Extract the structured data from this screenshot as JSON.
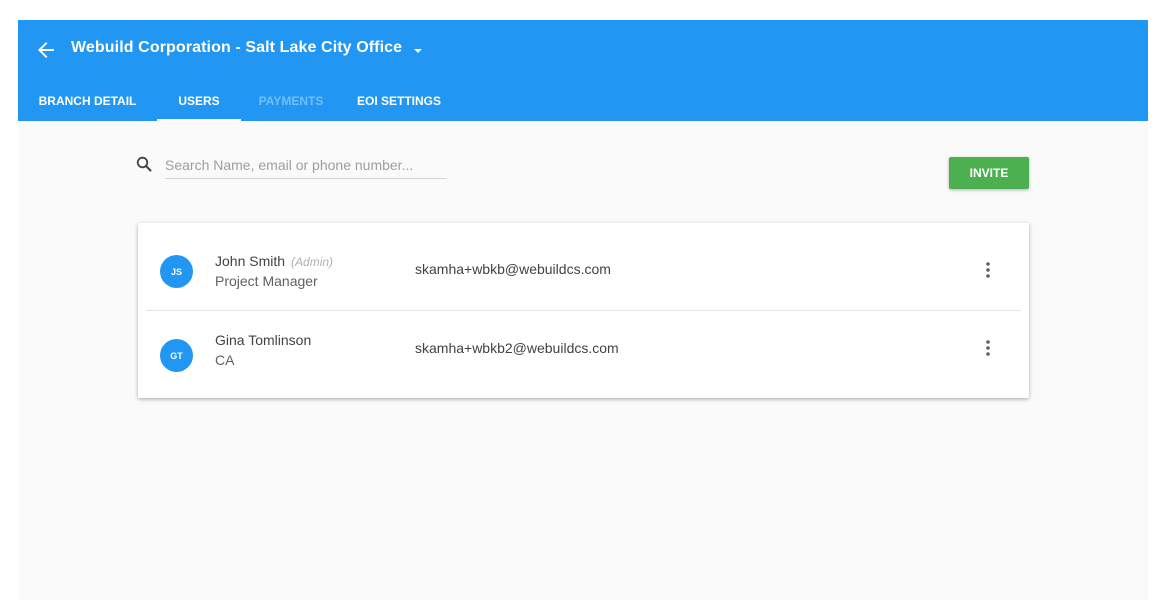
{
  "appbar": {
    "title": "Webuild Corporation - Salt Lake City Office",
    "back_icon": "arrow-left-icon",
    "caret_icon": "caret-down-icon",
    "color": "#2196f3"
  },
  "tabs": [
    {
      "label": "BRANCH DETAIL",
      "state": "normal"
    },
    {
      "label": "USERS",
      "state": "active"
    },
    {
      "label": "PAYMENTS",
      "state": "disabled"
    },
    {
      "label": "EOI SETTINGS",
      "state": "normal"
    }
  ],
  "search": {
    "placeholder": "Search Name, email or phone number...",
    "value": "",
    "icon": "search-icon"
  },
  "invite": {
    "label": "INVITE",
    "color": "#4caf50"
  },
  "users": [
    {
      "initials": "JS",
      "name": "John Smith",
      "tag": "(Admin)",
      "role": "Project Manager",
      "email": "skamha+wbkb@webuildcs.com",
      "menu_icon": "more-vertical-icon"
    },
    {
      "initials": "GT",
      "name": "Gina Tomlinson",
      "tag": "",
      "role": "CA",
      "email": "skamha+wbkb2@webuildcs.com",
      "menu_icon": "more-vertical-icon"
    }
  ]
}
